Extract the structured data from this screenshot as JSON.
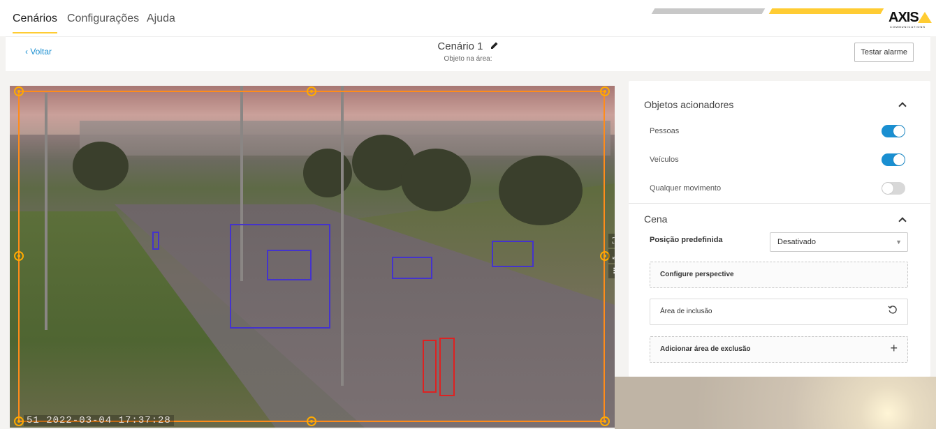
{
  "nav": {
    "tabs": [
      {
        "label": "Cenários"
      },
      {
        "label": "Configurações"
      },
      {
        "label": "Ajuda"
      }
    ],
    "logo_text": "AXIS",
    "logo_sub": "COMMUNICATIONS"
  },
  "header": {
    "back_label": "‹ Voltar",
    "scenario_title": "Cenário 1",
    "scenario_subtitle": "Objeto na área:",
    "test_button": "Testar alarme"
  },
  "video": {
    "timestamp": "51 2022-03-04 17:37:28"
  },
  "panel": {
    "triggers": {
      "title": "Objetos acionadores",
      "options": [
        {
          "label": "Pessoas",
          "enabled": true
        },
        {
          "label": "Veículos",
          "enabled": true
        },
        {
          "label": "Qualquer movimento",
          "enabled": false
        }
      ]
    },
    "scene": {
      "title": "Cena",
      "preset_label": "Posição predefinida",
      "preset_value": "Desativado",
      "configure_perspective": "Configure perspective",
      "inclusion_area": "Área de inclusão",
      "add_exclusion": "Adicionar área de exclusão"
    }
  },
  "colors": {
    "accent": "#1a8fd1",
    "brand_yellow": "#ffcc33",
    "inclusion_frame": "#ff8c1a",
    "detection_vehicle": "#4433cc",
    "detection_person": "#dd2222"
  }
}
